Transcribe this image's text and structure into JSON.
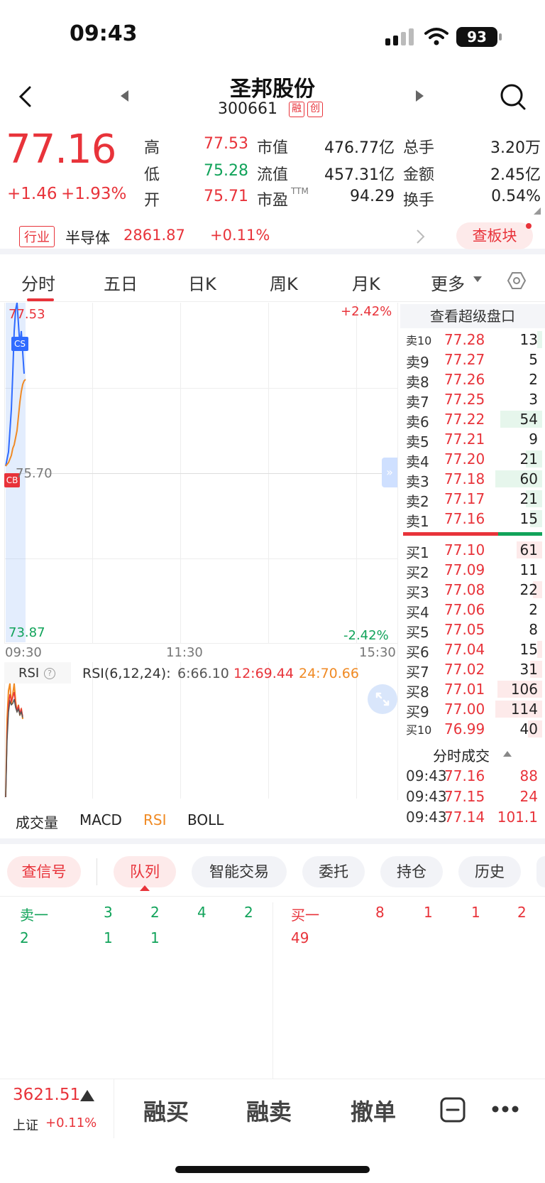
{
  "status_bar": {
    "time": "09:43",
    "battery": "93"
  },
  "header": {
    "name": "圣邦股份",
    "code": "300661",
    "tag_margin": "融",
    "tag_chinext": "创"
  },
  "quote": {
    "price": "77.16",
    "change_abs": "+1.46",
    "change_pct": "+1.93%",
    "high_label": "高",
    "high": "77.53",
    "low_label": "低",
    "low": "75.28",
    "open_label": "开",
    "open": "75.71",
    "mcap_label": "市值",
    "mcap": "476.77亿",
    "float_label": "流值",
    "float_cap": "457.31亿",
    "pe_label": "市盈",
    "pe_sup": "TTM",
    "pe": "94.29",
    "vol_label": "总手",
    "volume": "3.20万",
    "amt_label": "金额",
    "amount": "2.45亿",
    "turn_label": "换手",
    "turnover": "0.54%"
  },
  "industry": {
    "tag": "行业",
    "name": "半导体",
    "index": "2861.87",
    "change": "+0.11%",
    "board_button": "查板块"
  },
  "tabs": [
    "分时",
    "五日",
    "日K",
    "周K",
    "月K",
    "更多"
  ],
  "chart": {
    "price_high": "77.53",
    "price_mid": "75.70",
    "price_low": "73.87",
    "pct_high": "+2.42%",
    "pct_low": "-2.42%",
    "time_start": "09:30",
    "time_mid": "11:30",
    "time_end": "15:30",
    "marker_cs": "CS",
    "marker_cb": "CB",
    "rsi_label": "RSI",
    "rsi_params": "RSI(6,12,24):",
    "rsi6": "6:66.10",
    "rsi12": "12:69.44",
    "rsi24": "24:70.66",
    "indicators": [
      "成交量",
      "MACD",
      "RSI",
      "BOLL"
    ]
  },
  "order_book": {
    "title": "查看超级盘口",
    "asks": [
      {
        "label": "卖10",
        "price": "77.28",
        "vol": "13",
        "bar": 0.1
      },
      {
        "label": "卖9",
        "price": "77.27",
        "vol": "5",
        "bar": 0
      },
      {
        "label": "卖8",
        "price": "77.26",
        "vol": "2",
        "bar": 0
      },
      {
        "label": "卖7",
        "price": "77.25",
        "vol": "3",
        "bar": 0
      },
      {
        "label": "卖6",
        "price": "77.22",
        "vol": "54",
        "bar": 0.9
      },
      {
        "label": "卖5",
        "price": "77.21",
        "vol": "9",
        "bar": 0
      },
      {
        "label": "卖4",
        "price": "77.20",
        "vol": "21",
        "bar": 0.35
      },
      {
        "label": "卖3",
        "price": "77.18",
        "vol": "60",
        "bar": 1.0
      },
      {
        "label": "卖2",
        "price": "77.17",
        "vol": "21",
        "bar": 0.35
      },
      {
        "label": "卖1",
        "price": "77.16",
        "vol": "15",
        "bar": 0.25
      }
    ],
    "bids": [
      {
        "label": "买1",
        "price": "77.10",
        "vol": "61",
        "bar": 0.55
      },
      {
        "label": "买2",
        "price": "77.09",
        "vol": "11",
        "bar": 0
      },
      {
        "label": "买3",
        "price": "77.08",
        "vol": "22",
        "bar": 0.2
      },
      {
        "label": "买4",
        "price": "77.06",
        "vol": "2",
        "bar": 0
      },
      {
        "label": "买5",
        "price": "77.05",
        "vol": "8",
        "bar": 0
      },
      {
        "label": "买6",
        "price": "77.04",
        "vol": "15",
        "bar": 0.1
      },
      {
        "label": "买7",
        "price": "77.02",
        "vol": "31",
        "bar": 0.25
      },
      {
        "label": "买8",
        "price": "77.01",
        "vol": "106",
        "bar": 0.95
      },
      {
        "label": "买9",
        "price": "77.00",
        "vol": "114",
        "bar": 1.0
      },
      {
        "label": "买10",
        "price": "76.99",
        "vol": "40",
        "bar": 0.3
      }
    ],
    "ticks_title": "分时成交",
    "ticks": [
      {
        "time": "09:43",
        "price": "77.16",
        "vol": "88"
      },
      {
        "time": "09:43",
        "price": "77.15",
        "vol": "24"
      },
      {
        "time": "09:43",
        "price": "77.14",
        "vol": "101.1"
      }
    ]
  },
  "bottom_tabs": {
    "signal": "查信号",
    "queue": "队列",
    "smart": "智能交易",
    "entrust": "委托",
    "position": "持仓",
    "history": "历史"
  },
  "queue": {
    "sell_label": "卖一",
    "sell_row1": [
      "3",
      "2",
      "4",
      "2"
    ],
    "sell_row2": [
      "2",
      "1",
      "1"
    ],
    "buy_label": "买一",
    "buy_row1": [
      "8",
      "1",
      "1",
      "2"
    ],
    "buy_row2": [
      "49"
    ]
  },
  "footer": {
    "index_value": "3621.51",
    "index_name": "上证",
    "index_change": "+0.11%",
    "buy": "融买",
    "sell": "融卖",
    "cancel": "撤单"
  }
}
